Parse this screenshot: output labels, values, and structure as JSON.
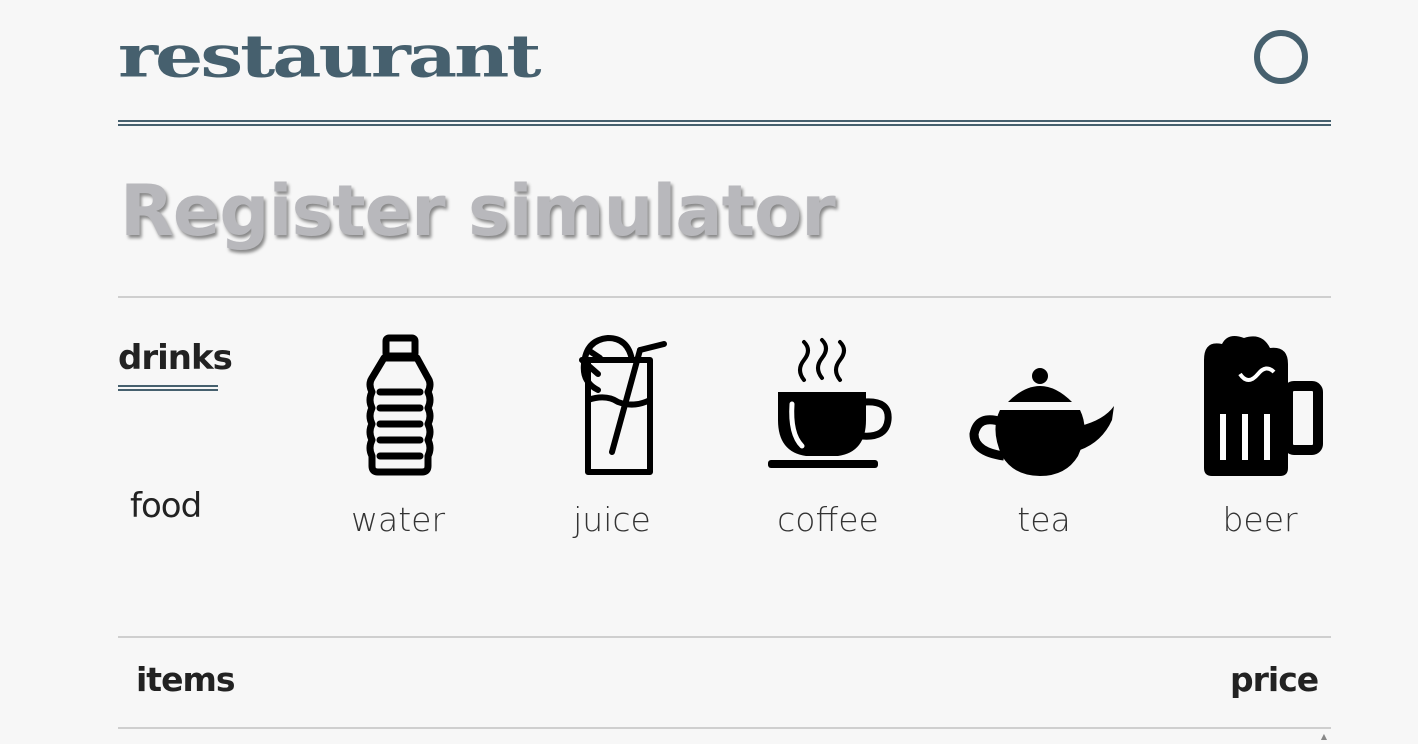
{
  "accent": "#46606e",
  "header": {
    "brand": "restaurant",
    "menu_icon": "circle-icon"
  },
  "page": {
    "title": "Register simulator"
  },
  "categories": [
    {
      "label": "drinks",
      "active": true
    },
    {
      "label": "food",
      "active": false
    }
  ],
  "products": [
    {
      "label": "water",
      "icon": "water-bottle-icon"
    },
    {
      "label": "juice",
      "icon": "juice-glass-icon"
    },
    {
      "label": "coffee",
      "icon": "coffee-cup-icon"
    },
    {
      "label": "tea",
      "icon": "teapot-icon"
    },
    {
      "label": "beer",
      "icon": "beer-mug-icon"
    }
  ],
  "table": {
    "items_header": "items",
    "price_header": "price"
  }
}
